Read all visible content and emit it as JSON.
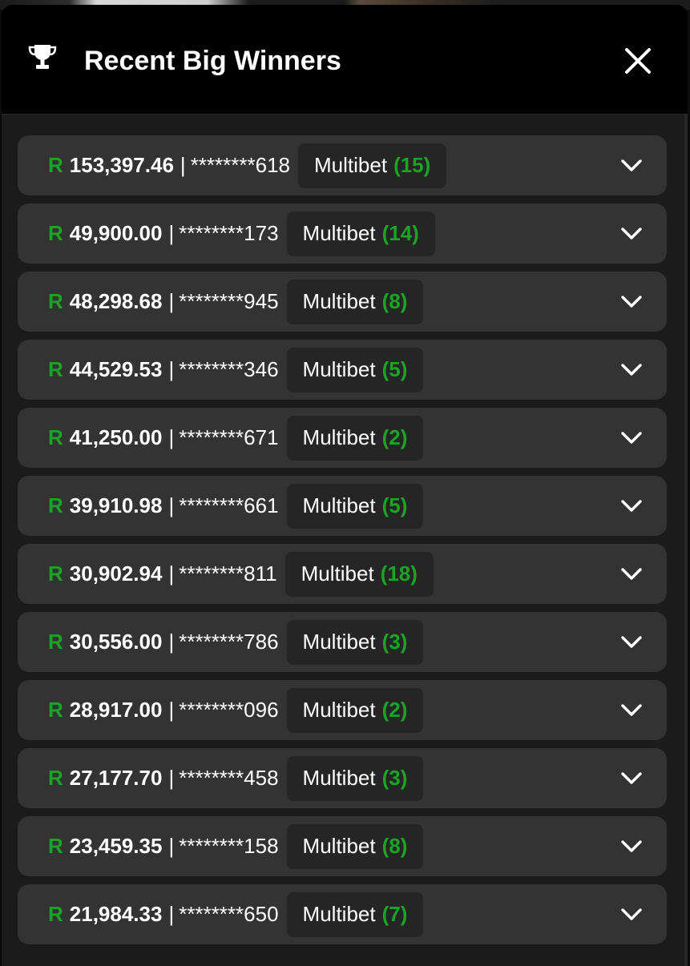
{
  "modal": {
    "title": "Recent Big Winners",
    "icons": {
      "trophy": "trophy-icon",
      "close": "close-icon",
      "expand": "chevron-down-icon"
    },
    "colors": {
      "accent_green": "#1aa324",
      "row_bg": "#333333",
      "badge_bg": "#252525"
    }
  },
  "winners": [
    {
      "currency": "R",
      "amount": "153,397.46",
      "separator": "|",
      "user": "********618",
      "bet_type": "Multibet",
      "count": "(15)"
    },
    {
      "currency": "R",
      "amount": "49,900.00",
      "separator": "|",
      "user": "********173",
      "bet_type": "Multibet",
      "count": "(14)"
    },
    {
      "currency": "R",
      "amount": "48,298.68",
      "separator": "|",
      "user": "********945",
      "bet_type": "Multibet",
      "count": "(8)"
    },
    {
      "currency": "R",
      "amount": "44,529.53",
      "separator": "|",
      "user": "********346",
      "bet_type": "Multibet",
      "count": "(5)"
    },
    {
      "currency": "R",
      "amount": "41,250.00",
      "separator": "|",
      "user": "********671",
      "bet_type": "Multibet",
      "count": "(2)"
    },
    {
      "currency": "R",
      "amount": "39,910.98",
      "separator": "|",
      "user": "********661",
      "bet_type": "Multibet",
      "count": "(5)"
    },
    {
      "currency": "R",
      "amount": "30,902.94",
      "separator": "|",
      "user": "********811",
      "bet_type": "Multibet",
      "count": "(18)"
    },
    {
      "currency": "R",
      "amount": "30,556.00",
      "separator": "|",
      "user": "********786",
      "bet_type": "Multibet",
      "count": "(3)"
    },
    {
      "currency": "R",
      "amount": "28,917.00",
      "separator": "|",
      "user": "********096",
      "bet_type": "Multibet",
      "count": "(2)"
    },
    {
      "currency": "R",
      "amount": "27,177.70",
      "separator": "|",
      "user": "********458",
      "bet_type": "Multibet",
      "count": "(3)"
    },
    {
      "currency": "R",
      "amount": "23,459.35",
      "separator": "|",
      "user": "********158",
      "bet_type": "Multibet",
      "count": "(8)"
    },
    {
      "currency": "R",
      "amount": "21,984.33",
      "separator": "|",
      "user": "********650",
      "bet_type": "Multibet",
      "count": "(7)"
    }
  ]
}
